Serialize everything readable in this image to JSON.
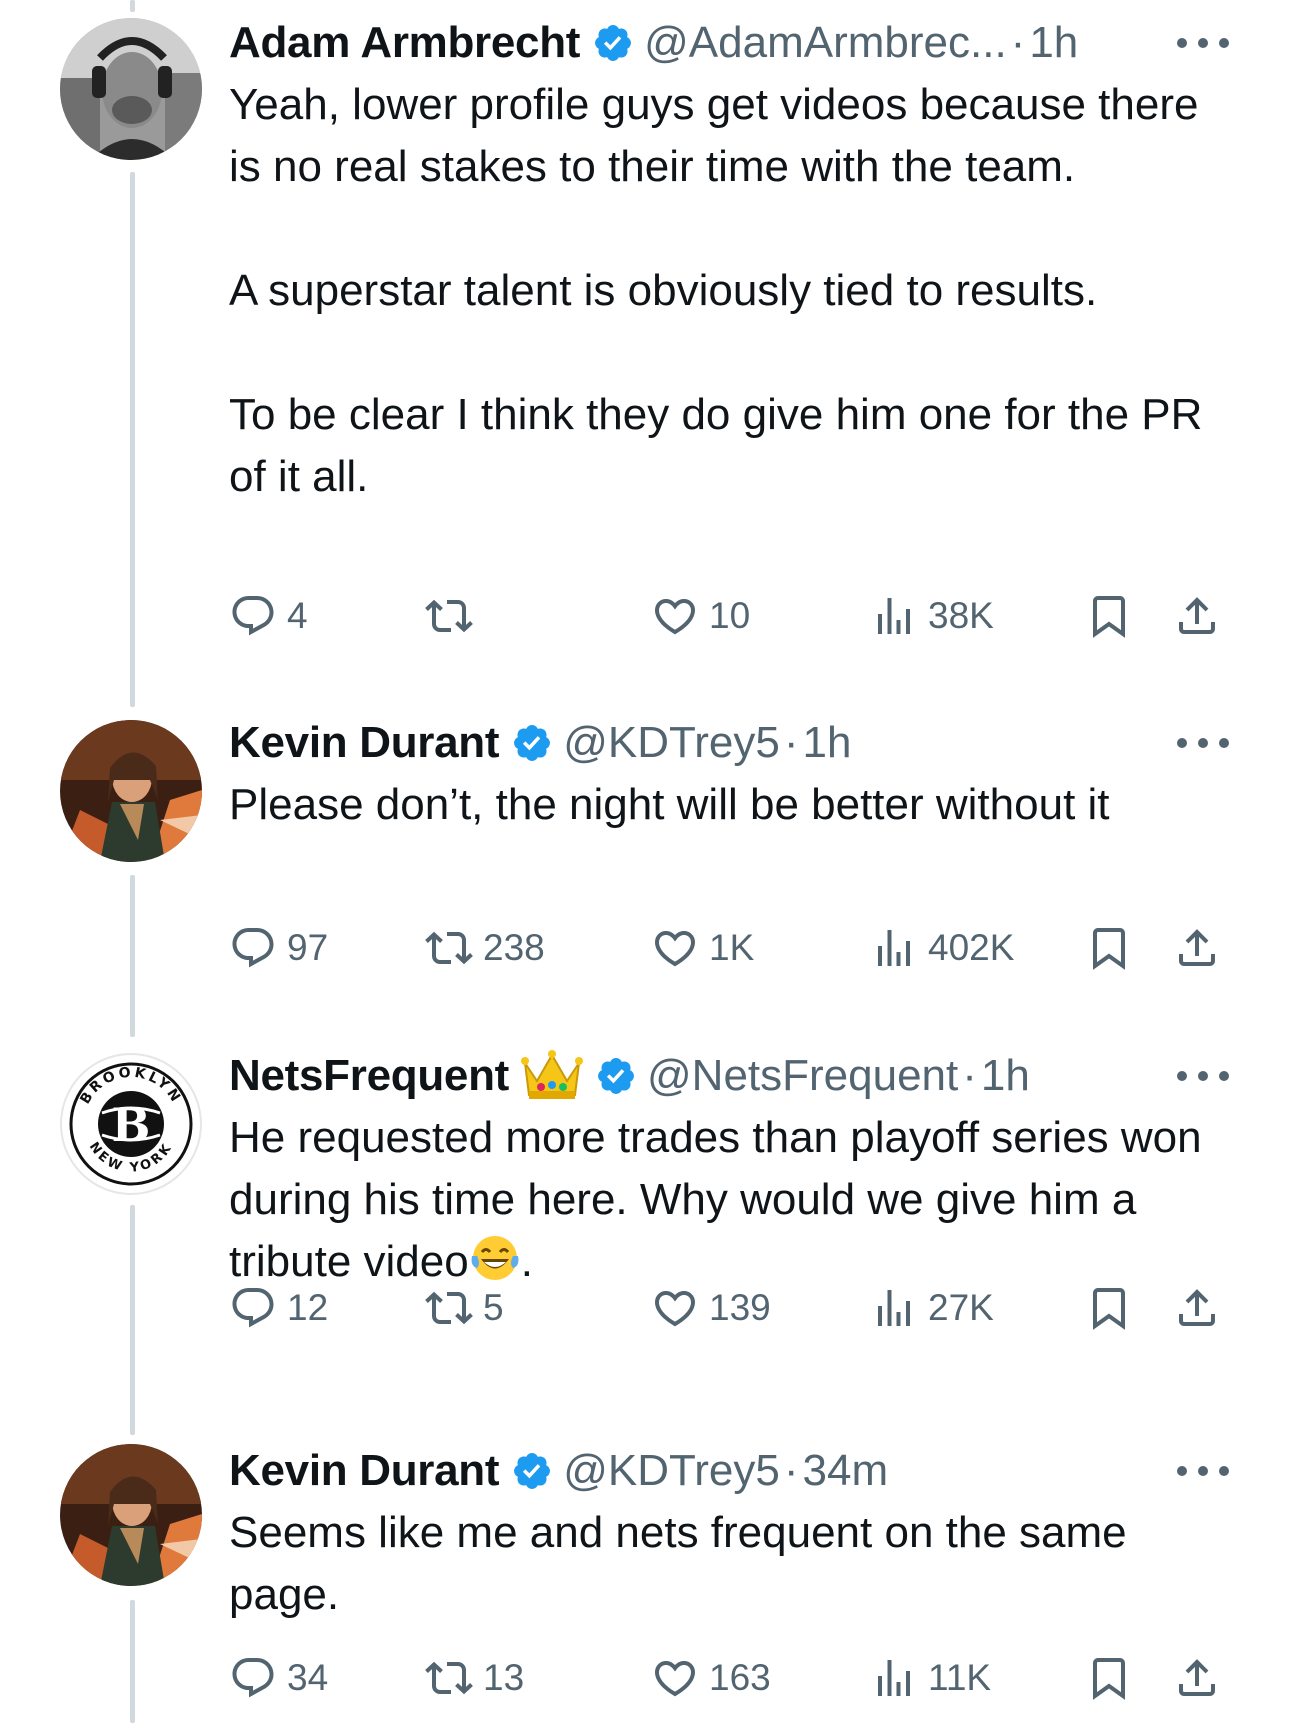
{
  "colors": {
    "text": "#0f1419",
    "secondary": "#536471",
    "verified": "#1d9bf0",
    "thread_line": "#cfd9de"
  },
  "tweets": [
    {
      "name": "Adam Armbrecht",
      "handle": "@AdamArmbrec...",
      "separator": "·",
      "time": "1h",
      "verified": true,
      "avatar": "headphones-man-photo",
      "paragraphs": [
        "Yeah, lower  profile guys get videos because there is no real stakes to their time with the team.",
        "",
        "A superstar talent is obviously tied to results.",
        "",
        "To be clear I think they do give him one for the PR of it all."
      ],
      "stats": {
        "replies": "4",
        "retweets": "",
        "likes": "10",
        "views": "38K"
      }
    },
    {
      "name": "Kevin Durant",
      "handle": "@KDTrey5",
      "separator": "·",
      "time": "1h",
      "verified": true,
      "avatar": "animated-character-avatar",
      "paragraphs": [
        "Please don’t, the night will be better without it"
      ],
      "stats": {
        "replies": "97",
        "retweets": "238",
        "likes": "1K",
        "views": "402K"
      }
    },
    {
      "name": "NetsFrequent",
      "handle": "@NetsFrequent",
      "separator": "·",
      "time": "1h",
      "verified": true,
      "avatar": "brooklyn-nets-logo",
      "logo_text": {
        "top": "BROOKLYN",
        "bottom": "NEW YORK",
        "letter": "B"
      },
      "paragraphs": [
        "He requested more trades than playoff series won during his time here. Why would we give him a tribute video"
      ],
      "text_suffix": ".",
      "emoji": "tears-of-joy-emoji",
      "stats": {
        "replies": "12",
        "retweets": "5",
        "likes": "139",
        "views": "27K"
      }
    },
    {
      "name": "Kevin Durant",
      "handle": "@KDTrey5",
      "separator": "·",
      "time": "34m",
      "verified": true,
      "avatar": "animated-character-avatar",
      "paragraphs": [
        "Seems like me and nets frequent on the same page."
      ],
      "stats": {
        "replies": "34",
        "retweets": "13",
        "likes": "163",
        "views": "11K"
      }
    }
  ]
}
